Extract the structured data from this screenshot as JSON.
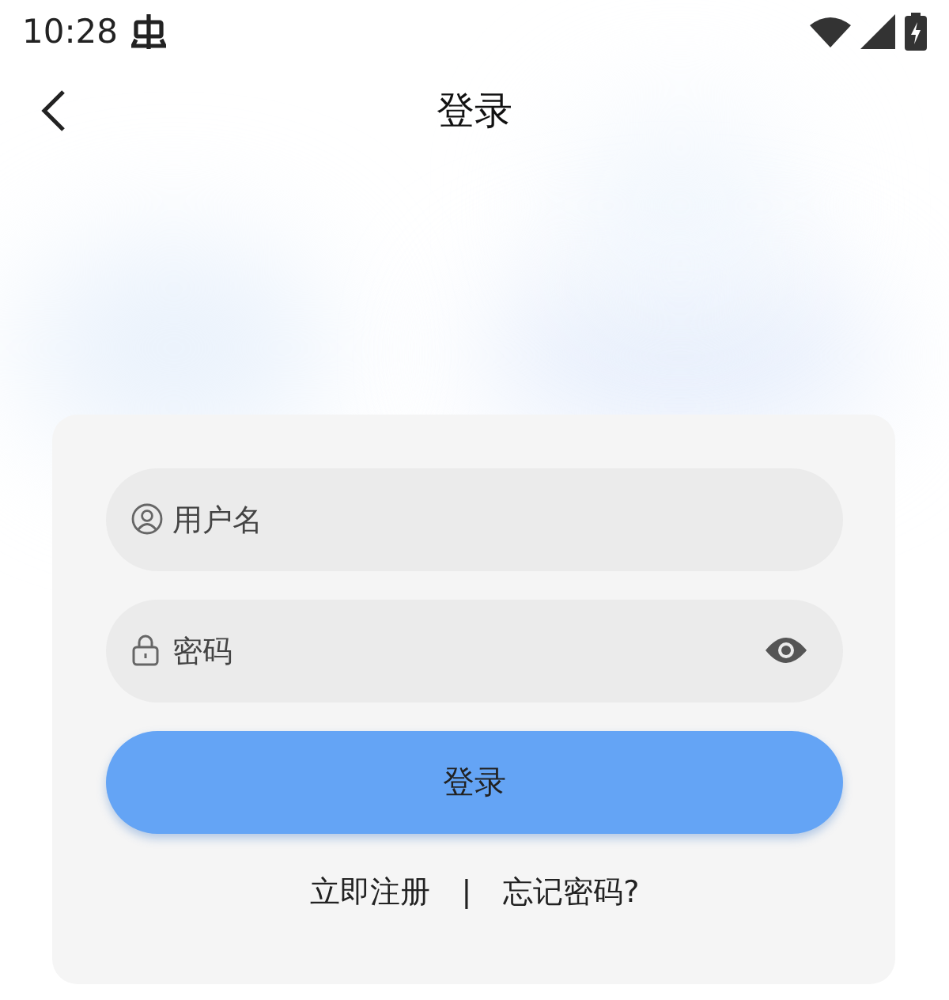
{
  "status_bar": {
    "time": "10:28"
  },
  "header": {
    "title": "登录"
  },
  "form": {
    "fields": [
      {
        "kind": "user",
        "placeholder": "用户名"
      },
      {
        "kind": "password",
        "placeholder": "密码"
      }
    ],
    "submit": "登录",
    "links": [
      {
        "label": "立即注册"
      },
      {
        "label": "忘记密码?"
      }
    ],
    "separator": "|"
  }
}
